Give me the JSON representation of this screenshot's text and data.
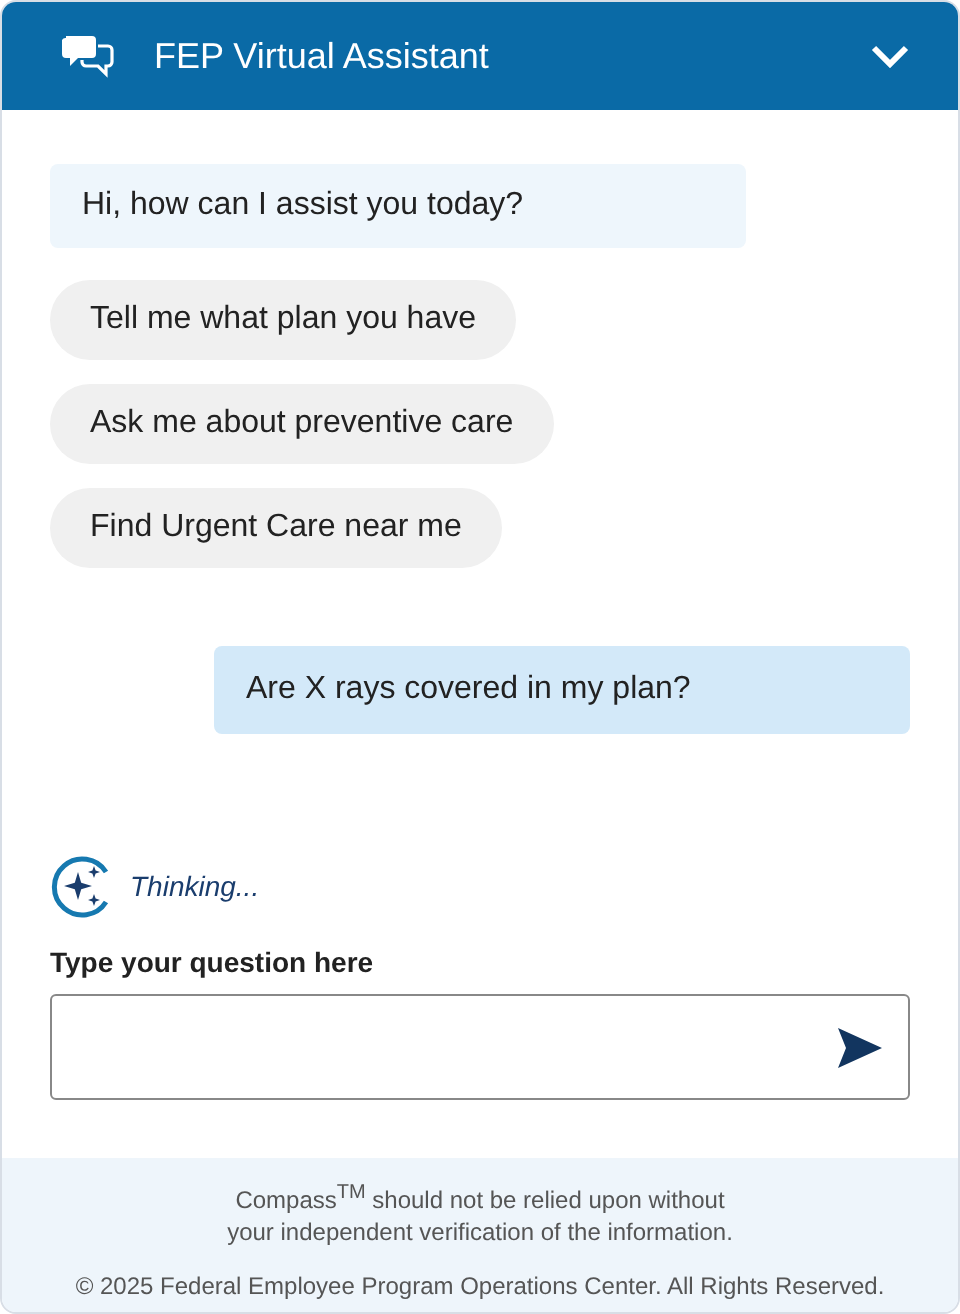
{
  "header": {
    "title": "FEP Virtual Assistant"
  },
  "messages": [
    {
      "kind": "bot",
      "text": "Hi, how can I assist you today?"
    },
    {
      "kind": "suggestion",
      "text": "Tell me what plan you have"
    },
    {
      "kind": "suggestion",
      "text": "Ask me about preventive care"
    },
    {
      "kind": "suggestion",
      "text": "Find Urgent Care near me"
    },
    {
      "kind": "user",
      "text": "Are X rays covered in my plan?"
    }
  ],
  "status": {
    "text": "Thinking..."
  },
  "composer": {
    "label": "Type your question here"
  },
  "footer": {
    "disclaimer": "Compass$^{TM}$ should not be relied upon without your independent verification of the information.",
    "copyright": "© 2025 Federal Employee Program Operations Center. All Rights Reserved."
  }
}
